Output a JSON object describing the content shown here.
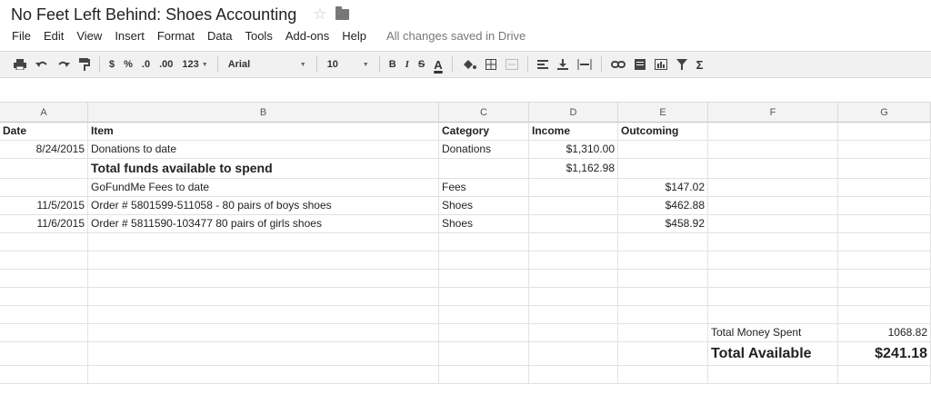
{
  "app": {
    "doc_title": "No Feet Left Behind: Shoes Accounting",
    "star_icon": "star-icon",
    "folder_icon": "folder-icon",
    "save_status": "All changes saved in Drive"
  },
  "menu": [
    "File",
    "Edit",
    "View",
    "Insert",
    "Format",
    "Data",
    "Tools",
    "Add-ons",
    "Help"
  ],
  "toolbar": {
    "currency": "$",
    "percent": "%",
    "dec_decrease": ".0",
    "dec_increase": ".00",
    "more_formats": "123",
    "font": "Arial",
    "font_size": "10",
    "bold": "B",
    "italic": "I",
    "strike": "S",
    "text_color": "A",
    "sigma": "Σ"
  },
  "columns": [
    "A",
    "B",
    "C",
    "D",
    "E",
    "F",
    "G"
  ],
  "rows": [
    [
      "Date",
      "Item",
      "Category",
      "Income",
      "Outcoming",
      "",
      ""
    ],
    [
      "8/24/2015",
      "Donations to date",
      "Donations",
      "$1,310.00",
      "",
      "",
      ""
    ],
    [
      "",
      "Total funds available to spend",
      "",
      "$1,162.98",
      "",
      "",
      ""
    ],
    [
      "",
      "GoFundMe Fees to date",
      "Fees",
      "",
      "$147.02",
      "",
      ""
    ],
    [
      "11/5/2015",
      "Order # 5801599-511058 - 80 pairs of boys shoes",
      "Shoes",
      "",
      "$462.88",
      "",
      ""
    ],
    [
      "11/6/2015",
      "Order # 5811590-103477 80 pairs of girls shoes",
      "Shoes",
      "",
      "$458.92",
      "",
      ""
    ],
    [
      "",
      "",
      "",
      "",
      "",
      "",
      ""
    ],
    [
      "",
      "",
      "",
      "",
      "",
      "",
      ""
    ],
    [
      "",
      "",
      "",
      "",
      "",
      "",
      ""
    ],
    [
      "",
      "",
      "",
      "",
      "",
      "",
      ""
    ],
    [
      "",
      "",
      "",
      "",
      "",
      "",
      ""
    ],
    [
      "",
      "",
      "",
      "",
      "",
      "Total Money Spent",
      "1068.82"
    ],
    [
      "",
      "",
      "",
      "",
      "",
      "Total Available",
      "$241.18"
    ],
    [
      "",
      "",
      "",
      "",
      "",
      "",
      ""
    ]
  ]
}
